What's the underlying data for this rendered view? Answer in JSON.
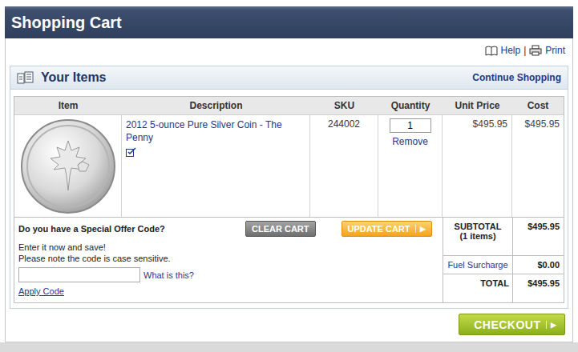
{
  "header": {
    "title": "Shopping Cart"
  },
  "toolbar": {
    "links": [
      "Help",
      "Print"
    ],
    "separator": "|"
  },
  "panel": {
    "title": "Your Items",
    "link": "Continue Shopping"
  },
  "table": {
    "columns": [
      "Item",
      "Description",
      "SKU",
      "Quantity",
      "Unit Price",
      "Cost"
    ],
    "rows": [
      {
        "description": "2012 5-ounce Pure Silver Coin - The Penny",
        "sku": "244002",
        "quantity": "1",
        "remove": "Remove",
        "unit_price": "$495.95",
        "cost": "$495.95"
      }
    ]
  },
  "offer": {
    "title": "Do you have a Special Offer Code?",
    "lines": [
      "Enter it now and save!",
      "Please note the code is case sensitive."
    ],
    "value": "",
    "help_link": "What is this?",
    "apply": "Apply Code"
  },
  "buttons": {
    "clear": "CLEAR CART",
    "update": "UPDATE CART",
    "update_arrow": "▶",
    "checkout": "CHECKOUT",
    "checkout_arrow": "▶"
  },
  "summary": [
    {
      "label": "SUBTOTAL",
      "note": "(1 items)",
      "value": "$495.95",
      "kind": "subtotal"
    },
    {
      "label": "Fuel Surcharge",
      "value": "$0.00",
      "kind": "link"
    },
    {
      "label": "TOTAL",
      "value": "$495.95",
      "kind": "total"
    }
  ]
}
